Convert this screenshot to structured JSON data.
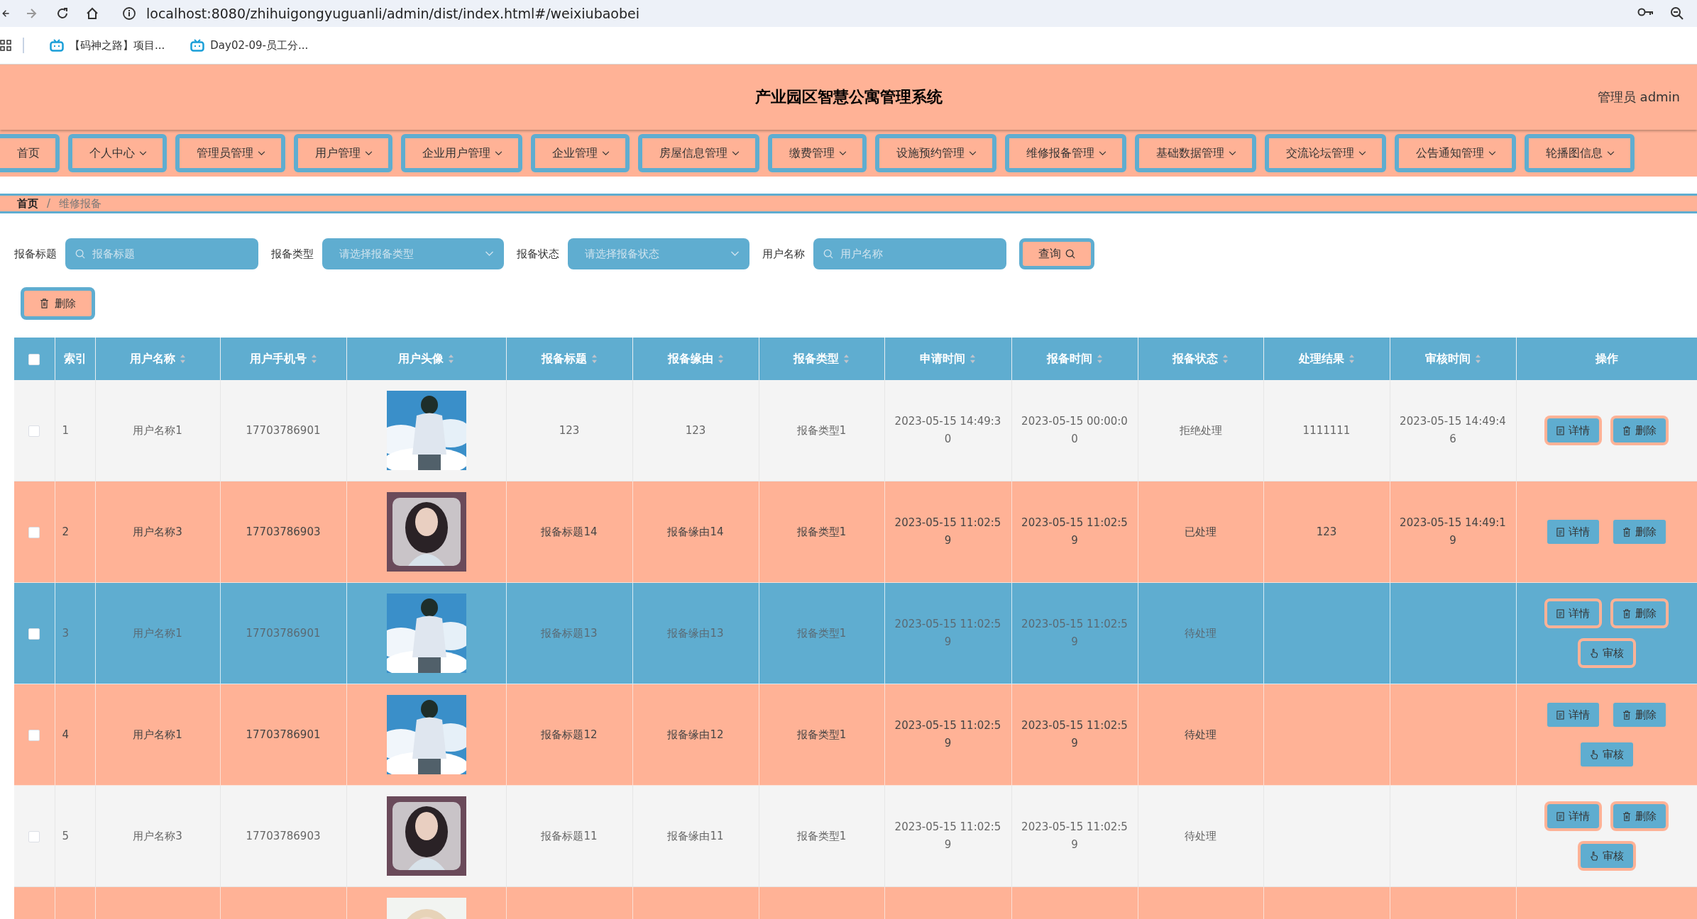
{
  "browser": {
    "url": "localhost:8080/zhihuigongyuguanli/admin/dist/index.html#/weixiubaobei",
    "bookmarks": [
      "【码神之路】项目...",
      "Day02-09-员工分..."
    ]
  },
  "header": {
    "title": "产业园区智慧公寓管理系统",
    "user": "管理员 admin"
  },
  "nav": [
    {
      "label": "首页",
      "has_menu": false
    },
    {
      "label": "个人中心",
      "has_menu": true
    },
    {
      "label": "管理员管理",
      "has_menu": true
    },
    {
      "label": "用户管理",
      "has_menu": true
    },
    {
      "label": "企业用户管理",
      "has_menu": true
    },
    {
      "label": "企业管理",
      "has_menu": true
    },
    {
      "label": "房屋信息管理",
      "has_menu": true
    },
    {
      "label": "缴费管理",
      "has_menu": true
    },
    {
      "label": "设施预约管理",
      "has_menu": true
    },
    {
      "label": "维修报备管理",
      "has_menu": true
    },
    {
      "label": "基础数据管理",
      "has_menu": true
    },
    {
      "label": "交流论坛管理",
      "has_menu": true
    },
    {
      "label": "公告通知管理",
      "has_menu": true
    },
    {
      "label": "轮播图信息",
      "has_menu": true
    }
  ],
  "breadcrumb": {
    "items": [
      "首页",
      "维修报备"
    ],
    "separator": "/"
  },
  "search": {
    "fields": [
      {
        "label": "报备标题",
        "kind": "input",
        "placeholder": "报备标题"
      },
      {
        "label": "报备类型",
        "kind": "select",
        "placeholder": "请选择报备类型"
      },
      {
        "label": "报备状态",
        "kind": "select",
        "placeholder": "请选择报备状态"
      },
      {
        "label": "用户名称",
        "kind": "input",
        "placeholder": "用户名称"
      }
    ],
    "button": "查询"
  },
  "toolbar": {
    "delete_button": "删除"
  },
  "table": {
    "header_checked": false,
    "columns": [
      {
        "label": "索引",
        "sortable": false
      },
      {
        "label": "用户名称",
        "sortable": true
      },
      {
        "label": "用户手机号",
        "sortable": true
      },
      {
        "label": "用户头像",
        "sortable": true
      },
      {
        "label": "报备标题",
        "sortable": true
      },
      {
        "label": "报备缘由",
        "sortable": true
      },
      {
        "label": "报备类型",
        "sortable": true
      },
      {
        "label": "申请时间",
        "sortable": true
      },
      {
        "label": "报备时间",
        "sortable": true
      },
      {
        "label": "报备状态",
        "sortable": true
      },
      {
        "label": "处理结果",
        "sortable": true
      },
      {
        "label": "审核时间",
        "sortable": true
      },
      {
        "label": "操作",
        "sortable": false
      }
    ],
    "rows": [
      {
        "checked": false,
        "selected": false,
        "outlined_actions": true,
        "cells": [
          "1",
          "用户名称1",
          "17703786901",
          {
            "kind": "picture"
          },
          "123",
          "123",
          "报备类型1",
          "2023-05-15 14:49:30",
          "2023-05-15 00:00:00",
          "拒绝处理",
          "1111111",
          "2023-05-15 14:49:46"
        ],
        "actions": [
          {
            "label": "详情",
            "kind": "detail"
          },
          {
            "label": "删除",
            "kind": "delete"
          }
        ]
      },
      {
        "checked": false,
        "selected": false,
        "outlined_actions": false,
        "cells": [
          "2",
          "用户名称3",
          "17703786903",
          {
            "kind": "picture"
          },
          "报备标题14",
          "报备缘由14",
          "报备类型1",
          "2023-05-15 11:02:59",
          "2023-05-15 11:02:59",
          "已处理",
          "123",
          "2023-05-15 14:49:19"
        ],
        "actions": [
          {
            "label": "详情",
            "kind": "detail"
          },
          {
            "label": "删除",
            "kind": "delete"
          }
        ]
      },
      {
        "checked": false,
        "selected": true,
        "outlined_actions": true,
        "cells": [
          "3",
          "用户名称1",
          "17703786901",
          {
            "kind": "picture"
          },
          "报备标题13",
          "报备缘由13",
          "报备类型1",
          "2023-05-15 11:02:59",
          "2023-05-15 11:02:59",
          "待处理",
          "",
          ""
        ],
        "actions": [
          {
            "label": "详情",
            "kind": "detail"
          },
          {
            "label": "删除",
            "kind": "delete"
          },
          {
            "label": "审核",
            "kind": "review"
          }
        ]
      },
      {
        "checked": false,
        "selected": false,
        "outlined_actions": false,
        "cells": [
          "4",
          "用户名称1",
          "17703786901",
          {
            "kind": "picture"
          },
          "报备标题12",
          "报备缘由12",
          "报备类型1",
          "2023-05-15 11:02:59",
          "2023-05-15 11:02:59",
          "待处理",
          "",
          ""
        ],
        "actions": [
          {
            "label": "详情",
            "kind": "detail"
          },
          {
            "label": "删除",
            "kind": "delete"
          },
          {
            "label": "审核",
            "kind": "review"
          }
        ]
      },
      {
        "checked": false,
        "selected": false,
        "outlined_actions": true,
        "cells": [
          "5",
          "用户名称3",
          "17703786903",
          {
            "kind": "picture"
          },
          "报备标题11",
          "报备缘由11",
          "报备类型1",
          "2023-05-15 11:02:59",
          "2023-05-15 11:02:59",
          "待处理",
          "",
          ""
        ],
        "actions": [
          {
            "label": "详情",
            "kind": "detail"
          },
          {
            "label": "删除",
            "kind": "delete"
          },
          {
            "label": "审核",
            "kind": "review"
          }
        ]
      },
      {
        "selected": false,
        "cells": [
          "",
          "",
          "",
          {
            "kind": "picture"
          }
        ]
      }
    ]
  }
}
